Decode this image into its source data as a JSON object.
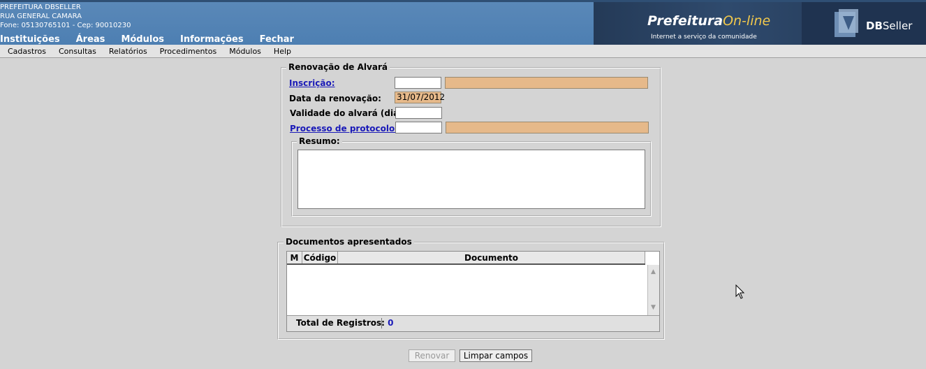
{
  "header": {
    "institution": "PREFEITURA DBSELLER",
    "address": "RUA GENERAL CAMARA",
    "contact": "Fone: 05130765101  -  Cep: 90010230",
    "top_menu": [
      "Instituições",
      "Áreas",
      "Módulos",
      "Informações",
      "Fechar"
    ],
    "brand_main": "Prefeitura",
    "brand_online": "On-line",
    "brand_sub": "Internet a serviço da comunidade",
    "db_bold": "DB",
    "db_rest": "Seller"
  },
  "menubar": [
    "Cadastros",
    "Consultas",
    "Relatórios",
    "Procedimentos",
    "Módulos",
    "Help"
  ],
  "form": {
    "legend": "Renovação de Alvará",
    "inscricao_label": "Inscrição:",
    "inscricao_value": "",
    "inscricao_desc": "",
    "data_label": "Data da renovação:",
    "data_value": "31/07/2012",
    "validade_label": "Validade do alvará (dias):",
    "validade_value": "",
    "processo_label": "Processo de protocolo:",
    "processo_value": "",
    "processo_desc": "",
    "resumo_legend": "Resumo:",
    "resumo_value": ""
  },
  "documents": {
    "legend": "Documentos apresentados",
    "columns": [
      "M",
      "Código",
      "Documento"
    ],
    "rows": [],
    "total_label": "Total de Registros:",
    "total_value": "0"
  },
  "buttons": {
    "renovar": "Renovar",
    "limpar": "Limpar campos"
  },
  "colors": {
    "header_bg": "#4d7fb2",
    "readonly_bg": "#e6b98a",
    "link": "#1a1ab8"
  }
}
